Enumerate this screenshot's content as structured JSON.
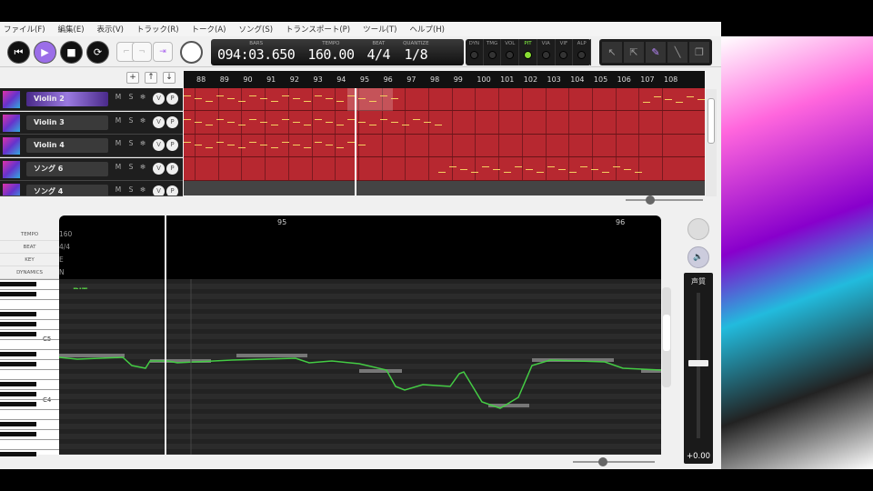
{
  "menu": [
    "ファイル(F)",
    "編集(E)",
    "表示(V)",
    "トラック(R)",
    "トーク(A)",
    "ソング(S)",
    "トランスポート(P)",
    "ツール(T)",
    "ヘルプ(H)"
  ],
  "transport": {
    "bars_label": "BARS",
    "bars": "094:03.650",
    "tempo_label": "TEMPO",
    "tempo": "160.00",
    "beat_label": "BEAT",
    "beat": "4/4",
    "quantize_label": "QUANTIZE",
    "quantize": "1/8"
  },
  "params": [
    {
      "label": "DYN",
      "on": false
    },
    {
      "label": "TMG",
      "on": false
    },
    {
      "label": "VOL",
      "on": false
    },
    {
      "label": "PIT",
      "on": true
    },
    {
      "label": "VIA",
      "on": false
    },
    {
      "label": "VIF",
      "on": false
    },
    {
      "label": "ALP",
      "on": false
    }
  ],
  "tracks": [
    {
      "name": "Violin 2",
      "selected": true
    },
    {
      "name": "Violin 3"
    },
    {
      "name": "Violin 4"
    },
    {
      "name": "ソング 6"
    },
    {
      "name": "ソング 4"
    }
  ],
  "track_buttons": {
    "m": "M",
    "s": "S",
    "freeze": "❄",
    "v": "V",
    "p": "P"
  },
  "ruler": [
    "88",
    "89",
    "90",
    "91",
    "92",
    "93",
    "94",
    "95",
    "96",
    "97",
    "98",
    "99",
    "100",
    "101",
    "102",
    "103",
    "104",
    "105",
    "106",
    "107",
    "108"
  ],
  "editor": {
    "labels": {
      "tempo": "TEMPO",
      "beat": "BEAT",
      "key": "KEY",
      "dynamics": "DYNAMICS"
    },
    "values": {
      "tempo": "160",
      "beat": "4/4",
      "key": "E",
      "dynamics": "N"
    },
    "bars": [
      "95",
      "96"
    ],
    "mode": "PIT",
    "c5": "C5",
    "c4": "C4"
  },
  "voice": {
    "label": "声質",
    "value": "+0.00"
  }
}
